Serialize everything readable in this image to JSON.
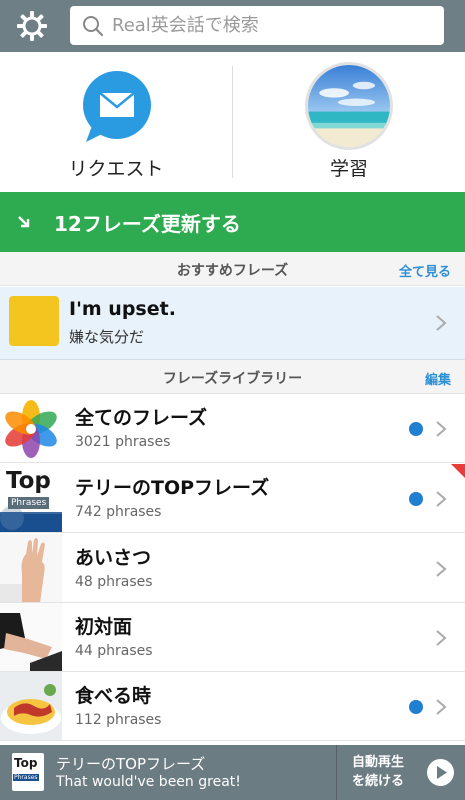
{
  "search": {
    "placeholder": "Real英会話で検索"
  },
  "tiles": [
    {
      "label": "リクエスト",
      "icon": "mail-bubble-icon"
    },
    {
      "label": "学習",
      "icon": "beach-photo"
    }
  ],
  "update": {
    "label": "12フレーズ更新する",
    "color": "#2eaa50"
  },
  "recommended": {
    "header": "おすすめフレーズ",
    "action": "全て見る",
    "phrase_en": "I'm upset.",
    "phrase_jp": "嫌な気分だ"
  },
  "library": {
    "header": "フレーズライブラリー",
    "action": "編集",
    "items": [
      {
        "title": "全てのフレーズ",
        "count": "3021 phrases",
        "new_dot": true
      },
      {
        "title": "テリーのTOPフレーズ",
        "count": "742 phrases",
        "new_dot": true,
        "flag": true
      },
      {
        "title": "あいさつ",
        "count": "48 phrases",
        "new_dot": false
      },
      {
        "title": "初対面",
        "count": "44 phrases",
        "new_dot": false
      },
      {
        "title": "食べる時",
        "count": "112 phrases",
        "new_dot": true
      }
    ]
  },
  "top_badge": {
    "line1": "Top",
    "line2": "Phrases"
  },
  "player": {
    "title": "テリーのTOPフレーズ",
    "subtitle": "That would've been great!",
    "auto_line1": "自動再生",
    "auto_line2": "を続ける"
  },
  "colors": {
    "accent": "#2d8fd5",
    "topbar": "#6f7f86",
    "dot": "#1f7fd0"
  }
}
